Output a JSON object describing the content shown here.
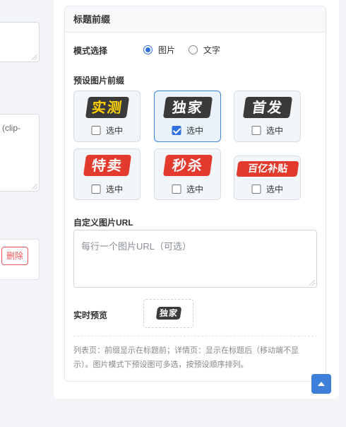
{
  "left_column": {
    "textarea_partial_text": "(clip-",
    "delete_button": "删除"
  },
  "panel": {
    "title": "标题前缀",
    "mode": {
      "label": "模式选择",
      "options": [
        {
          "label": "图片",
          "checked": true
        },
        {
          "label": "文字",
          "checked": false
        }
      ]
    },
    "presets": {
      "label": "预设图片前缀",
      "items": [
        {
          "text": "实测",
          "style": "dark-yellow",
          "check_label": "选中",
          "checked": false
        },
        {
          "text": "独家",
          "style": "dark",
          "check_label": "选中",
          "checked": true
        },
        {
          "text": "首发",
          "style": "dark",
          "check_label": "选中",
          "checked": false
        },
        {
          "text": "特卖",
          "style": "red",
          "check_label": "选中",
          "checked": false
        },
        {
          "text": "秒杀",
          "style": "red",
          "check_label": "选中",
          "checked": false
        },
        {
          "text": "百亿补贴",
          "style": "red",
          "check_label": "选中",
          "checked": false
        }
      ]
    },
    "custom_url": {
      "label": "自定义图片URL",
      "placeholder": "每行一个图片URL（可选）"
    },
    "preview": {
      "label": "实时预览",
      "logo_text": "独家"
    },
    "note": "列表页：前缀显示在标题前；详情页：显示在标题后（移动端不显示）。图片模式下预设图可多选，按预设顺序排列。"
  },
  "colors": {
    "accent": "#2f6fe0",
    "danger": "#e4555a",
    "logo_dark": "#3a3a3a",
    "logo_red": "#e23b2e",
    "logo_yellow": "#ffd200"
  }
}
